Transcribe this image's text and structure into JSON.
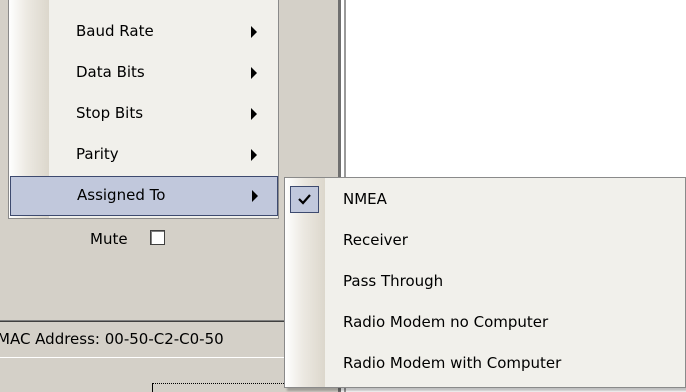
{
  "menu": {
    "items": [
      {
        "label": "Baud Rate",
        "has_submenu": true,
        "active": false
      },
      {
        "label": "Data Bits",
        "has_submenu": true,
        "active": false
      },
      {
        "label": "Stop Bits",
        "has_submenu": true,
        "active": false
      },
      {
        "label": "Parity",
        "has_submenu": true,
        "active": false
      },
      {
        "label": "Assigned To",
        "has_submenu": true,
        "active": true
      }
    ]
  },
  "submenu": {
    "items": [
      {
        "label": "NMEA",
        "checked": true
      },
      {
        "label": "Receiver",
        "checked": false
      },
      {
        "label": "Pass Through",
        "checked": false
      },
      {
        "label": "Radio Modem no Computer",
        "checked": false
      },
      {
        "label": "Radio Modem with Computer",
        "checked": false
      }
    ]
  },
  "mute": {
    "label": "Mute",
    "checked": false
  },
  "status": {
    "text": "MAC Address: 00-50-C2-C0-50"
  },
  "colors": {
    "panel": "#d4d0c8",
    "menu_bg": "#f1f0eb",
    "highlight": "#c1c8dc",
    "highlight_border": "#3d4a6f"
  }
}
